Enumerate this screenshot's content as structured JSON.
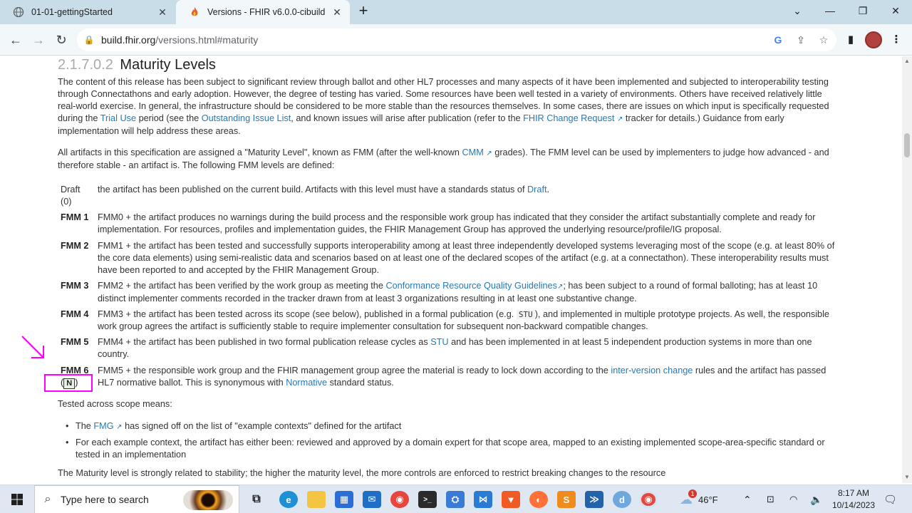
{
  "browser": {
    "tabs": [
      {
        "title": "01-01-gettingStarted",
        "active": false
      },
      {
        "title": "Versions - FHIR v6.0.0-cibuild",
        "active": true
      }
    ],
    "url_host": "build.fhir.org",
    "url_path": "/versions.html#maturity"
  },
  "page": {
    "heading_number": "2.1.7.0.2",
    "heading_title": "Maturity Levels",
    "intro": {
      "p1": "The content of this release has been subject to significant review through ballot and other HL7 processes and many aspects of it have been implemented and subjected to interoperability testing through Connectathons and early adoption. However, the degree of testing has varied. Some resources have been well tested in a variety of environments. Others have received relatively little real-world exercise. In general, the infrastructure should be considered to be more stable than the resources themselves. In some cases, there are issues on which input is specifically requested during the",
      "link_trial_use": "Trial Use",
      "p2": "period (see the",
      "link_outstanding": "Outstanding Issue List",
      "p3": ", and known issues will arise after publication (refer to the",
      "link_change_request": "FHIR Change Request",
      "p4": "tracker for details.) Guidance from early implementation will help address these areas."
    },
    "fmm_intro": {
      "p1": "All artifacts in this specification are assigned a \"Maturity Level\", known as FMM (after the well-known",
      "link_cmm": "CMM",
      "p2": "grades). The FMM level can be used by implementers to judge how advanced - and therefore stable - an artifact is. The following FMM levels are defined:"
    },
    "levels": {
      "draft_label": "Draft",
      "draft_sub": "(0)",
      "draft_text": "the artifact has been published on the current build. Artifacts with this level must have a standards status of",
      "draft_link": "Draft",
      "fmm1_label": "FMM 1",
      "fmm1_text": "FMM0 + the artifact produces no warnings during the build process and the responsible work group has indicated that they consider the artifact substantially complete and ready for implementation. For resources, profiles and implementation guides, the FHIR Management Group has approved the underlying resource/profile/IG proposal.",
      "fmm2_label": "FMM 2",
      "fmm2_text": "FMM1 + the artifact has been tested and successfully supports interoperability among at least three independently developed systems leveraging most of the scope (e.g. at least 80% of the core data elements) using semi-realistic data and scenarios based on at least one of the declared scopes of the artifact (e.g. at a connectathon). These interoperability results must have been reported to and accepted by the FHIR Management Group.",
      "fmm3_label": "FMM 3",
      "fmm3_a": "FMM2 + the artifact has been verified by the work group as meeting the",
      "fmm3_link": "Conformance Resource Quality Guidelines",
      "fmm3_b": "; has been subject to a round of formal balloting; has at least 10 distinct implementer comments recorded in the tracker drawn from at least 3 organizations resulting in at least one substantive change.",
      "fmm4_label": "FMM 4",
      "fmm4_a": "FMM3 + the artifact has been tested across its scope (see below), published in a formal publication (e.g.",
      "fmm4_code": "STU",
      "fmm4_b": "), and implemented in multiple prototype projects. As well, the responsible work group agrees the artifact is sufficiently stable to require implementer consultation for subsequent non-backward compatible changes.",
      "fmm5_label": "FMM 5",
      "fmm5_a": "FMM4 + the artifact has been published in two formal publication release cycles as",
      "fmm5_link": "STU",
      "fmm5_b": "and has been implemented in at least 5 independent production systems in more than one country.",
      "fmm6_label": "FMM 6",
      "fmm6_badge": "N",
      "fmm6_a": "FMM5 + the responsible work group and the FHIR management group agree the material is ready to lock down according to the",
      "fmm6_link1": "inter-version change",
      "fmm6_b": "rules and the artifact has passed HL7 normative ballot. This is synonymous with",
      "fmm6_link2": "Normative",
      "fmm6_c": "standard status."
    },
    "scope_heading": "Tested across scope means:",
    "bullets": {
      "b1_a": "The",
      "b1_link": "FMG",
      "b1_b": "has signed off on the list of \"example contexts\" defined for the artifact",
      "b2": "For each example context, the artifact has either been: reviewed and approved by a domain expert for that scope area, mapped to an existing implemented scope-area-specific standard or tested in an implementation"
    },
    "closing": "The Maturity level is strongly related to stability; the higher the maturity level, the more controls are enforced to restrict breaking changes to the resource"
  },
  "taskbar": {
    "search_placeholder": "Type here to search",
    "weather_temp": "46°F",
    "weather_badge": "1",
    "time": "8:17 AM",
    "date": "10/14/2023"
  },
  "colors": {
    "link": "#2779b5",
    "annotation": "#ff00ff"
  }
}
